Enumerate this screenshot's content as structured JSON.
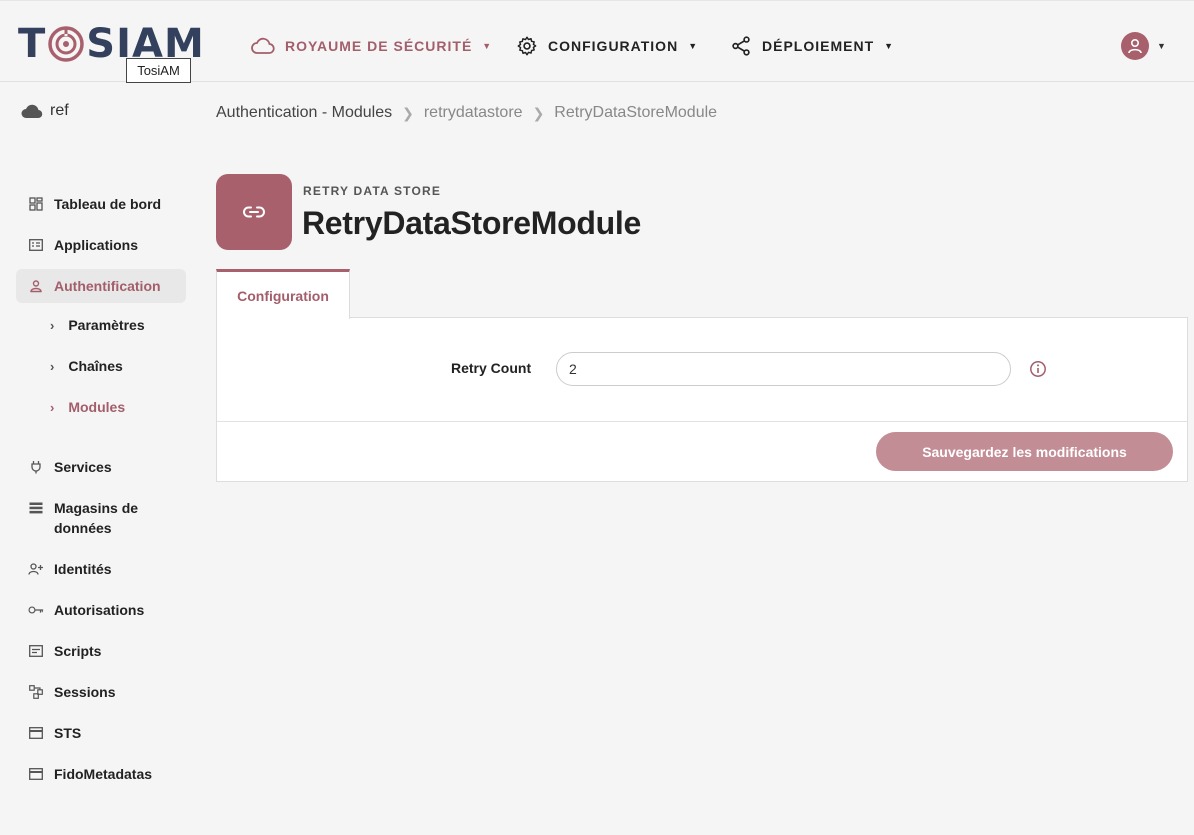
{
  "app": {
    "logo_text_left": "T",
    "logo_text_right": "SIAM",
    "logo_tooltip": "TosiAM"
  },
  "nav": {
    "realm_label": "ROYAUME DE SÉCURITÉ",
    "config_label": "CONFIGURATION",
    "deploy_label": "DÉPLOIEMENT"
  },
  "realm": {
    "name": "ref"
  },
  "breadcrumb": {
    "items": [
      "Authentication - Modules",
      "retrydatastore",
      "RetryDataStoreModule"
    ]
  },
  "sidebar": {
    "items": [
      {
        "label": "Tableau de bord",
        "icon": "dashboard-icon"
      },
      {
        "label": "Applications",
        "icon": "applications-icon"
      },
      {
        "label": "Authentification",
        "icon": "person-icon"
      },
      {
        "label": "Services",
        "icon": "plug-icon"
      },
      {
        "label": "Magasins de données",
        "icon": "list-icon"
      },
      {
        "label": "Identités",
        "icon": "identities-icon"
      },
      {
        "label": "Autorisations",
        "icon": "key-icon"
      },
      {
        "label": "Scripts",
        "icon": "scripts-icon"
      },
      {
        "label": "Sessions",
        "icon": "sessions-icon"
      },
      {
        "label": "STS",
        "icon": "card-icon"
      },
      {
        "label": "FidoMetadatas",
        "icon": "card-icon"
      }
    ],
    "sub_items": [
      "Paramètres",
      "Chaînes",
      "Modules"
    ],
    "magasins_line1": "Magasins de",
    "magasins_line2": "données"
  },
  "page": {
    "subtitle": "RETRY DATA STORE",
    "title": "RetryDataStoreModule",
    "icon": "link-icon"
  },
  "tabs": [
    {
      "label": "Configuration"
    }
  ],
  "form": {
    "retry_count_label": "Retry Count",
    "retry_count_value": "2",
    "save_label": "Sauvegardez les modifications"
  },
  "colors": {
    "accent": "#a8606c",
    "accent_text": "#a35e6b",
    "button": "#c38d95",
    "logo_navy": "#33415e"
  }
}
